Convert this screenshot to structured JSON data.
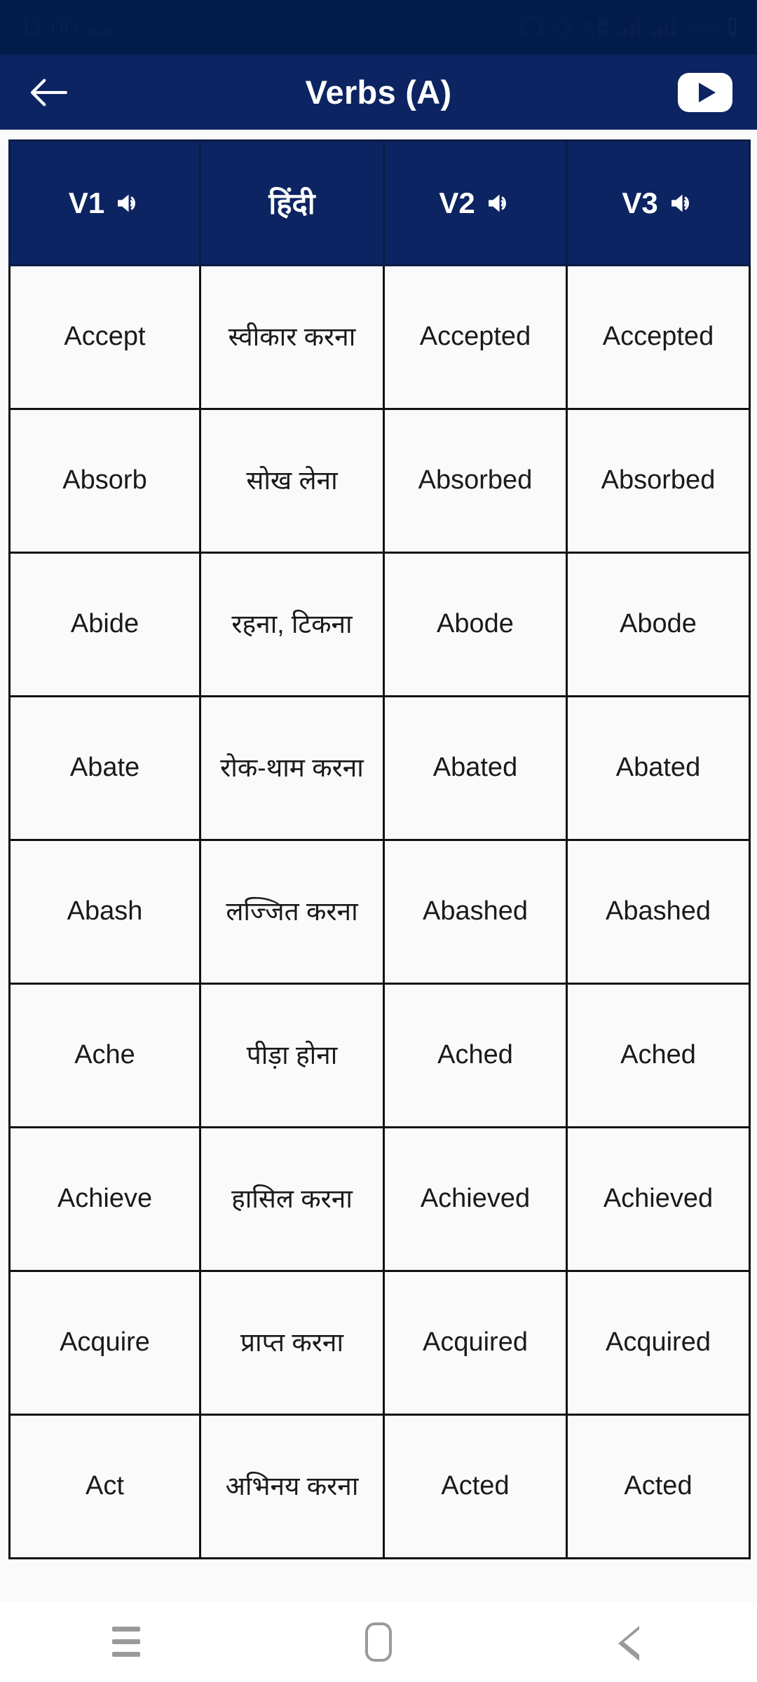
{
  "status_bar": {
    "time": "11:00",
    "small_label": "01:26",
    "battery": "15%",
    "icons": [
      "headset-icon",
      "vibrate-icon",
      "volte-icon",
      "signal-sim1-icon",
      "signal-sim2-icon"
    ]
  },
  "app_bar": {
    "back_label": "",
    "title": "Verbs (A)",
    "youtube_label": ""
  },
  "table": {
    "headers": [
      {
        "label": "V1",
        "speaker": true
      },
      {
        "label": "हिंदी",
        "speaker": false
      },
      {
        "label": "V2",
        "speaker": true
      },
      {
        "label": "V3",
        "speaker": true
      }
    ],
    "rows": [
      {
        "v1": "Accept",
        "hindi": "स्वीकार करना",
        "v2": "Accepted",
        "v3": "Accepted"
      },
      {
        "v1": "Absorb",
        "hindi": "सोख लेना",
        "v2": "Absorbed",
        "v3": "Absorbed"
      },
      {
        "v1": "Abide",
        "hindi": "रहना, टिकना",
        "v2": "Abode",
        "v3": "Abode"
      },
      {
        "v1": "Abate",
        "hindi": "रोक-थाम करना",
        "v2": "Abated",
        "v3": "Abated"
      },
      {
        "v1": "Abash",
        "hindi": "लज्जित करना",
        "v2": "Abashed",
        "v3": "Abashed"
      },
      {
        "v1": "Ache",
        "hindi": "पीड़ा होना",
        "v2": "Ached",
        "v3": "Ached"
      },
      {
        "v1": "Achieve",
        "hindi": "हासिल करना",
        "v2": "Achieved",
        "v3": "Achieved"
      },
      {
        "v1": "Acquire",
        "hindi": "प्राप्त करना",
        "v2": "Acquired",
        "v3": "Acquired"
      },
      {
        "v1": "Act",
        "hindi": "अभिनय करना",
        "v2": "Acted",
        "v3": "Acted"
      }
    ]
  },
  "nav_bar": {
    "recents_label": "",
    "home_label": "",
    "back_label": ""
  },
  "colors": {
    "status_bar_bg": "#031B4A",
    "app_bar_bg": "#0C2461",
    "table_header_bg": "#0C2461",
    "cell_bg": "#fafafa",
    "cell_border": "#111111",
    "text_dark": "#1a1a1a",
    "nav_icon": "#9a9a9a"
  }
}
